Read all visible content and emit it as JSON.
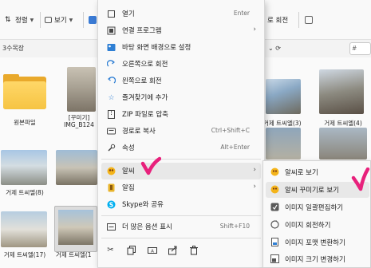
{
  "toolbar": {
    "sort_label": "정렬",
    "view_label": "보기",
    "rotate_label": "로 회전"
  },
  "address": {
    "path": "3수목장",
    "search_hint": "#"
  },
  "files": [
    {
      "name": "원본파일"
    },
    {
      "name": "[꾸미기]\nIMG_B124"
    },
    {
      "name": "거제 트씨엘(3)"
    },
    {
      "name": "거제 트씨엘(4)"
    },
    {
      "name": "거제 트씨엘(8)"
    },
    {
      "name": "거제 트씨엘(17)"
    },
    {
      "name": "거제 트씨엘(1"
    }
  ],
  "context_menu": {
    "items": [
      {
        "label": "열기",
        "shortcut": "Enter",
        "icon": "open-icon"
      },
      {
        "label": "연결 프로그램",
        "shortcut": "",
        "icon": "open-with-icon",
        "submenu": true
      },
      {
        "label": "바탕 화면 배경으로 설정",
        "shortcut": "",
        "icon": "wallpaper-icon"
      },
      {
        "label": "오른쪽으로 회전",
        "shortcut": "",
        "icon": "rotate-right-icon"
      },
      {
        "label": "왼쪽으로 회전",
        "shortcut": "",
        "icon": "rotate-left-icon"
      },
      {
        "label": "즐겨찾기에 추가",
        "shortcut": "",
        "icon": "star-icon"
      },
      {
        "label": "ZIP 파일로 압축",
        "shortcut": "",
        "icon": "zip-icon"
      },
      {
        "label": "경로로 복사",
        "shortcut": "Ctrl+Shift+C",
        "icon": "copy-path-icon"
      },
      {
        "label": "속성",
        "shortcut": "Alt+Enter",
        "icon": "properties-icon"
      },
      {
        "label": "알씨",
        "shortcut": "",
        "icon": "alsee-icon",
        "submenu": true
      },
      {
        "label": "알집",
        "shortcut": "",
        "icon": "alzip-icon",
        "submenu": true
      },
      {
        "label": "Skype와 공유",
        "shortcut": "",
        "icon": "skype-icon"
      },
      {
        "label": "더 많은 옵션 표시",
        "shortcut": "Shift+F10",
        "icon": "more-options-icon"
      }
    ],
    "bottom_icons": [
      "cut-icon",
      "copy-icon",
      "rename-icon",
      "share-icon",
      "delete-icon"
    ]
  },
  "submenu": {
    "items": [
      {
        "label": "알씨로 보기",
        "icon": "alsee-view-icon"
      },
      {
        "label": "알씨 꾸미기로 보기",
        "icon": "alsee-decorate-icon"
      },
      {
        "label": "이미지 일괄편집하기",
        "icon": "batch-edit-icon"
      },
      {
        "label": "이미지 회전하기",
        "icon": "rotate-image-icon"
      },
      {
        "label": "이미지 포맷 변환하기",
        "icon": "convert-format-icon"
      },
      {
        "label": "이미지 크기 변경하기",
        "icon": "resize-image-icon"
      }
    ]
  },
  "colors": {
    "accent": "#e8217c",
    "menu_bg": "#f9f9f9",
    "highlight": "#e8e8e8",
    "folder": "#f6c443"
  }
}
